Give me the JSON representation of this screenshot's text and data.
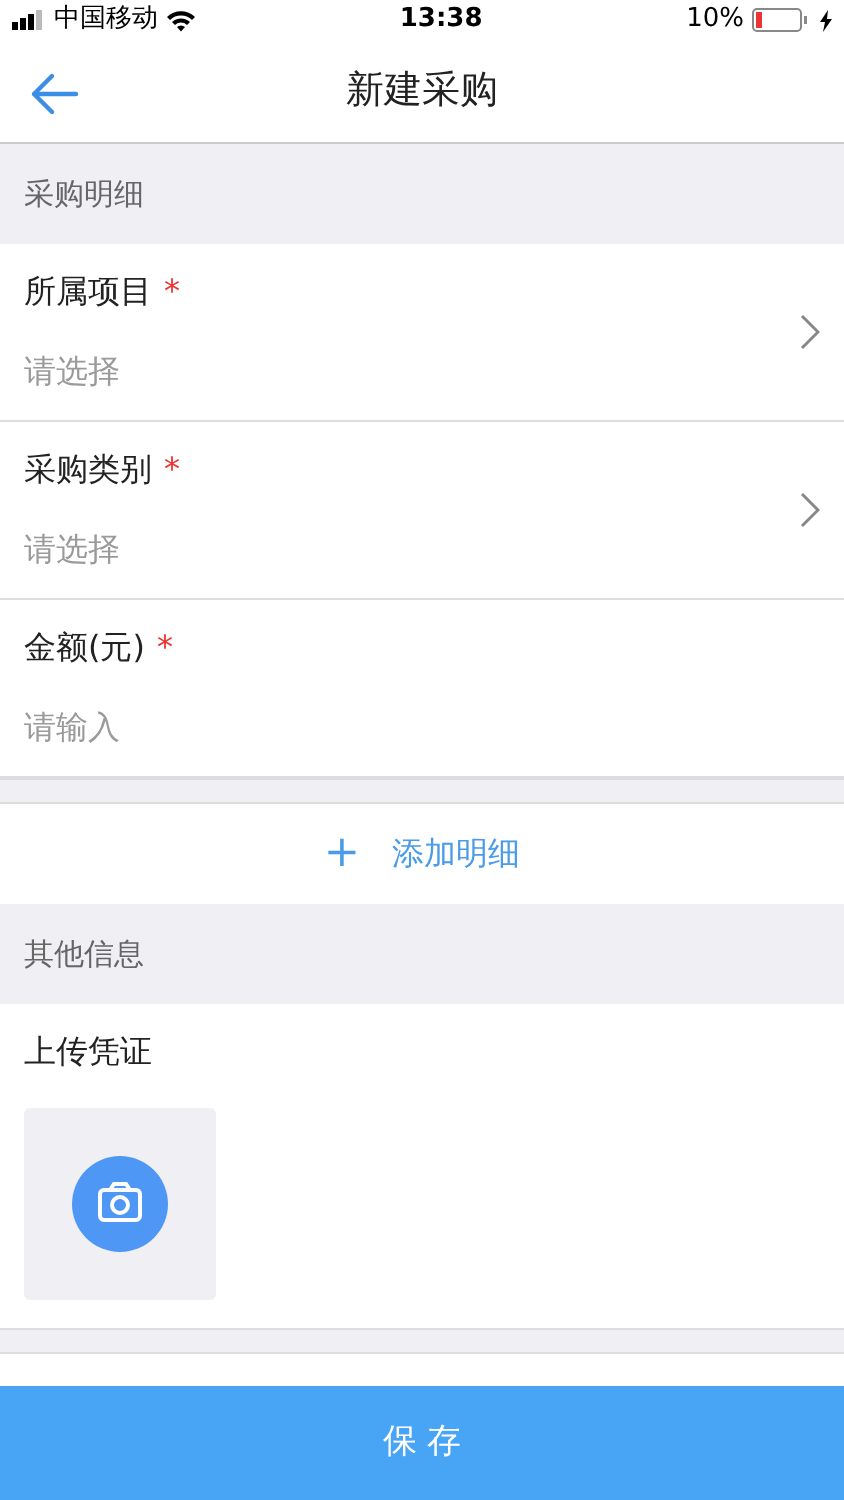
{
  "status_bar": {
    "carrier": "中国移动",
    "time": "13:38",
    "battery": "10%"
  },
  "nav": {
    "title": "新建采购"
  },
  "sections": [
    {
      "title": "采购明细",
      "fields": [
        {
          "label": "所属项目",
          "required_mark": "*",
          "kind": "select",
          "placeholder": "请选择"
        },
        {
          "label": "采购类别",
          "required_mark": "*",
          "kind": "select",
          "placeholder": "请选择"
        },
        {
          "label": "金额(元)",
          "required_mark": "*",
          "kind": "input",
          "placeholder": "请输入"
        }
      ]
    }
  ],
  "add_button": {
    "icon": "+",
    "label": "添加明细"
  },
  "other": {
    "title": "其他信息",
    "upload_label": "上传凭证"
  },
  "save_button": "保 存"
}
